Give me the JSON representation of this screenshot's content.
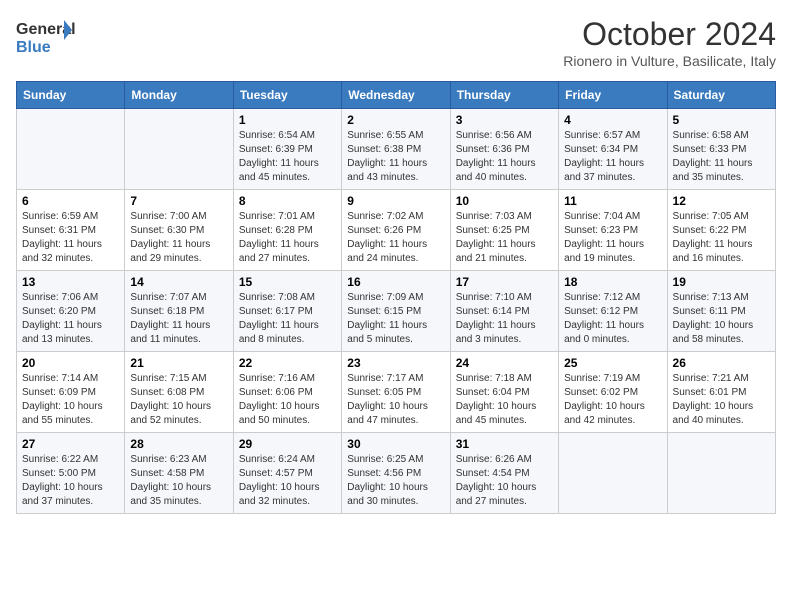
{
  "header": {
    "logo_general": "General",
    "logo_blue": "Blue",
    "month_title": "October 2024",
    "subtitle": "Rionero in Vulture, Basilicate, Italy"
  },
  "days_of_week": [
    "Sunday",
    "Monday",
    "Tuesday",
    "Wednesday",
    "Thursday",
    "Friday",
    "Saturday"
  ],
  "weeks": [
    [
      {
        "day": "",
        "info": ""
      },
      {
        "day": "",
        "info": ""
      },
      {
        "day": "1",
        "info": "Sunrise: 6:54 AM\nSunset: 6:39 PM\nDaylight: 11 hours and 45 minutes."
      },
      {
        "day": "2",
        "info": "Sunrise: 6:55 AM\nSunset: 6:38 PM\nDaylight: 11 hours and 43 minutes."
      },
      {
        "day": "3",
        "info": "Sunrise: 6:56 AM\nSunset: 6:36 PM\nDaylight: 11 hours and 40 minutes."
      },
      {
        "day": "4",
        "info": "Sunrise: 6:57 AM\nSunset: 6:34 PM\nDaylight: 11 hours and 37 minutes."
      },
      {
        "day": "5",
        "info": "Sunrise: 6:58 AM\nSunset: 6:33 PM\nDaylight: 11 hours and 35 minutes."
      }
    ],
    [
      {
        "day": "6",
        "info": "Sunrise: 6:59 AM\nSunset: 6:31 PM\nDaylight: 11 hours and 32 minutes."
      },
      {
        "day": "7",
        "info": "Sunrise: 7:00 AM\nSunset: 6:30 PM\nDaylight: 11 hours and 29 minutes."
      },
      {
        "day": "8",
        "info": "Sunrise: 7:01 AM\nSunset: 6:28 PM\nDaylight: 11 hours and 27 minutes."
      },
      {
        "day": "9",
        "info": "Sunrise: 7:02 AM\nSunset: 6:26 PM\nDaylight: 11 hours and 24 minutes."
      },
      {
        "day": "10",
        "info": "Sunrise: 7:03 AM\nSunset: 6:25 PM\nDaylight: 11 hours and 21 minutes."
      },
      {
        "day": "11",
        "info": "Sunrise: 7:04 AM\nSunset: 6:23 PM\nDaylight: 11 hours and 19 minutes."
      },
      {
        "day": "12",
        "info": "Sunrise: 7:05 AM\nSunset: 6:22 PM\nDaylight: 11 hours and 16 minutes."
      }
    ],
    [
      {
        "day": "13",
        "info": "Sunrise: 7:06 AM\nSunset: 6:20 PM\nDaylight: 11 hours and 13 minutes."
      },
      {
        "day": "14",
        "info": "Sunrise: 7:07 AM\nSunset: 6:18 PM\nDaylight: 11 hours and 11 minutes."
      },
      {
        "day": "15",
        "info": "Sunrise: 7:08 AM\nSunset: 6:17 PM\nDaylight: 11 hours and 8 minutes."
      },
      {
        "day": "16",
        "info": "Sunrise: 7:09 AM\nSunset: 6:15 PM\nDaylight: 11 hours and 5 minutes."
      },
      {
        "day": "17",
        "info": "Sunrise: 7:10 AM\nSunset: 6:14 PM\nDaylight: 11 hours and 3 minutes."
      },
      {
        "day": "18",
        "info": "Sunrise: 7:12 AM\nSunset: 6:12 PM\nDaylight: 11 hours and 0 minutes."
      },
      {
        "day": "19",
        "info": "Sunrise: 7:13 AM\nSunset: 6:11 PM\nDaylight: 10 hours and 58 minutes."
      }
    ],
    [
      {
        "day": "20",
        "info": "Sunrise: 7:14 AM\nSunset: 6:09 PM\nDaylight: 10 hours and 55 minutes."
      },
      {
        "day": "21",
        "info": "Sunrise: 7:15 AM\nSunset: 6:08 PM\nDaylight: 10 hours and 52 minutes."
      },
      {
        "day": "22",
        "info": "Sunrise: 7:16 AM\nSunset: 6:06 PM\nDaylight: 10 hours and 50 minutes."
      },
      {
        "day": "23",
        "info": "Sunrise: 7:17 AM\nSunset: 6:05 PM\nDaylight: 10 hours and 47 minutes."
      },
      {
        "day": "24",
        "info": "Sunrise: 7:18 AM\nSunset: 6:04 PM\nDaylight: 10 hours and 45 minutes."
      },
      {
        "day": "25",
        "info": "Sunrise: 7:19 AM\nSunset: 6:02 PM\nDaylight: 10 hours and 42 minutes."
      },
      {
        "day": "26",
        "info": "Sunrise: 7:21 AM\nSunset: 6:01 PM\nDaylight: 10 hours and 40 minutes."
      }
    ],
    [
      {
        "day": "27",
        "info": "Sunrise: 6:22 AM\nSunset: 5:00 PM\nDaylight: 10 hours and 37 minutes."
      },
      {
        "day": "28",
        "info": "Sunrise: 6:23 AM\nSunset: 4:58 PM\nDaylight: 10 hours and 35 minutes."
      },
      {
        "day": "29",
        "info": "Sunrise: 6:24 AM\nSunset: 4:57 PM\nDaylight: 10 hours and 32 minutes."
      },
      {
        "day": "30",
        "info": "Sunrise: 6:25 AM\nSunset: 4:56 PM\nDaylight: 10 hours and 30 minutes."
      },
      {
        "day": "31",
        "info": "Sunrise: 6:26 AM\nSunset: 4:54 PM\nDaylight: 10 hours and 27 minutes."
      },
      {
        "day": "",
        "info": ""
      },
      {
        "day": "",
        "info": ""
      }
    ]
  ]
}
